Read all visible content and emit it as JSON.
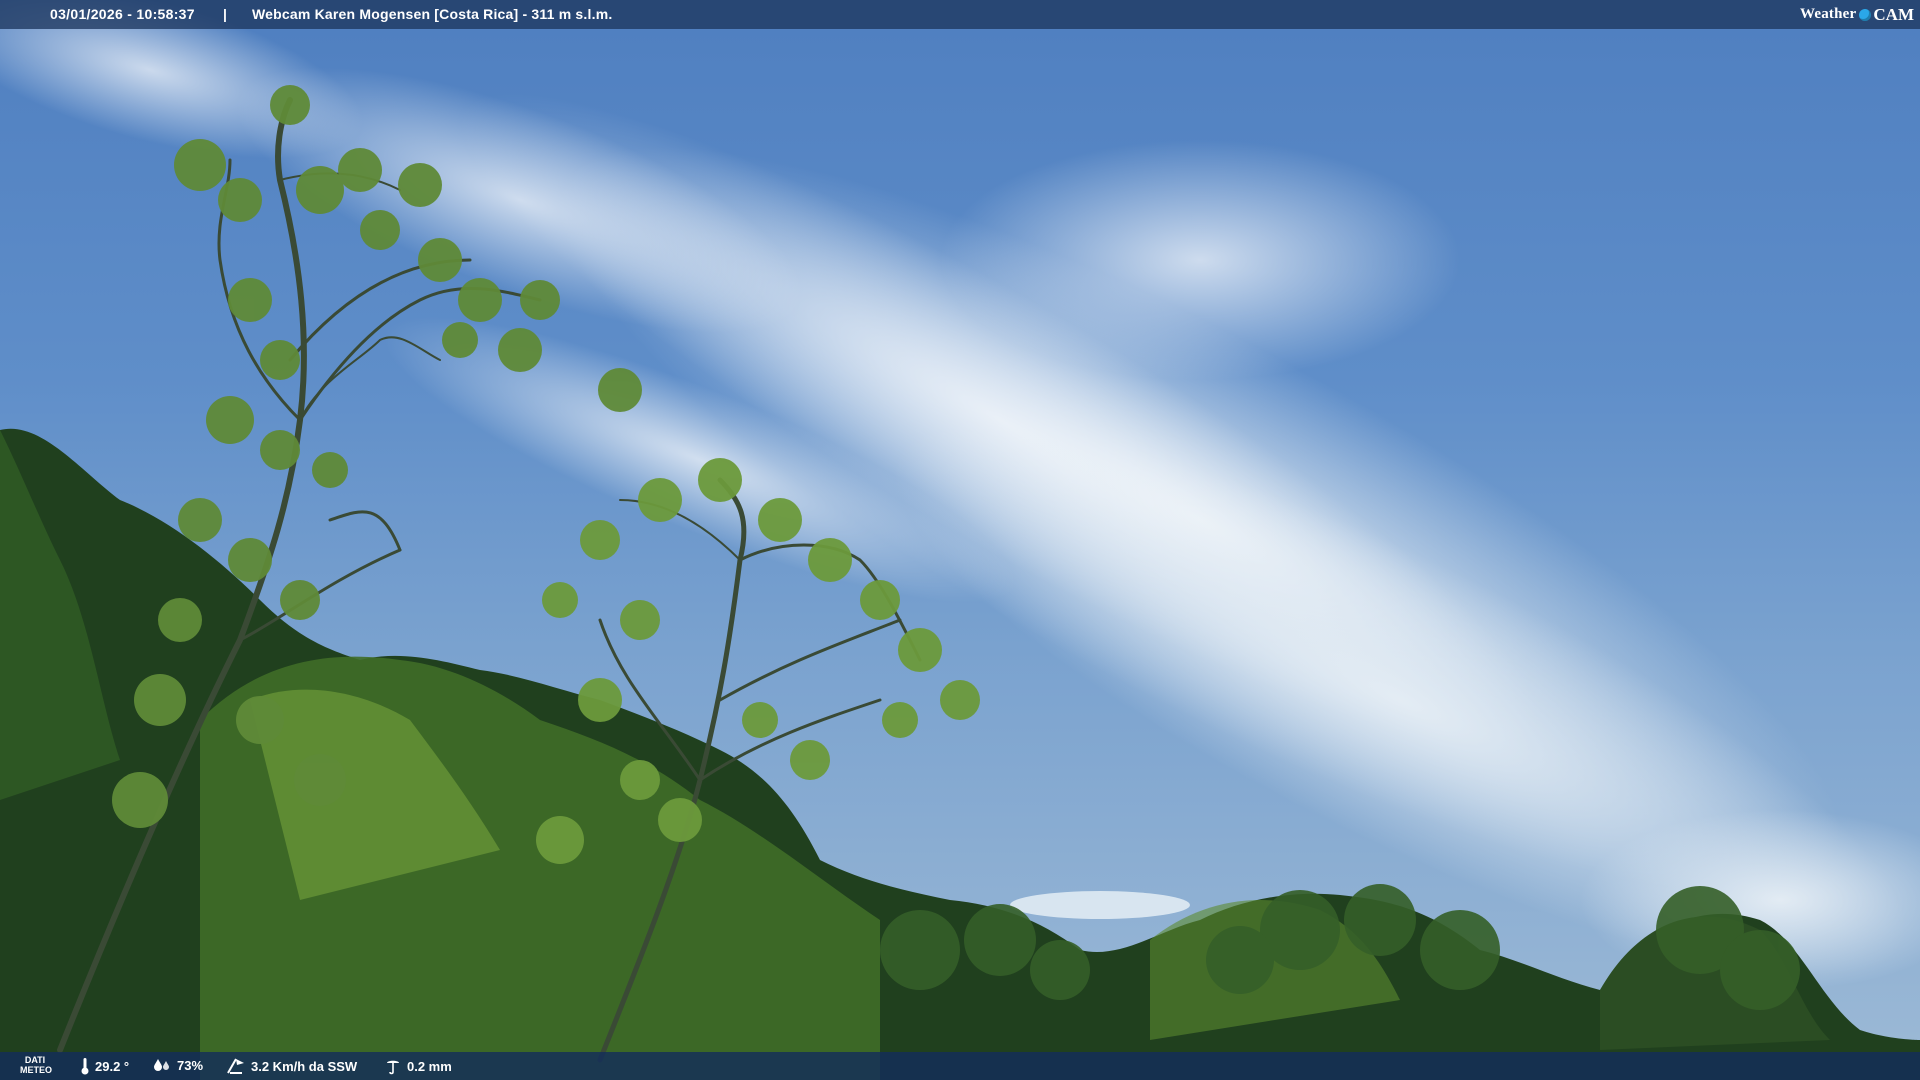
{
  "header": {
    "timestamp": "03/01/2026 - 10:58:37",
    "separator": "|",
    "camera_title": "Webcam Karen Mogensen [Costa Rica]  - 311 m s.l.m.",
    "logo_left": "Weather",
    "logo_right": "CAM"
  },
  "footer": {
    "section_label_line1": "DATI",
    "section_label_line2": "METEO",
    "temperature": "29.2 °",
    "humidity": "73%",
    "wind": "3.2 Km/h da SSW",
    "rain": "0.2 mm"
  },
  "icons": {
    "temperature": "thermometer-icon",
    "humidity": "humidity-drops-icon",
    "wind": "wind-icon",
    "rain": "rain-gauge-icon",
    "logo": "weathercam-logo"
  },
  "colors": {
    "sky_top": "#4f7fc0",
    "sky_bottom": "#9dbad6",
    "bar_background": "#1e375f",
    "foliage_dark": "#1f3a1c",
    "foliage_light": "#6f9a3a",
    "logo_dot": "#2aa8e8"
  }
}
